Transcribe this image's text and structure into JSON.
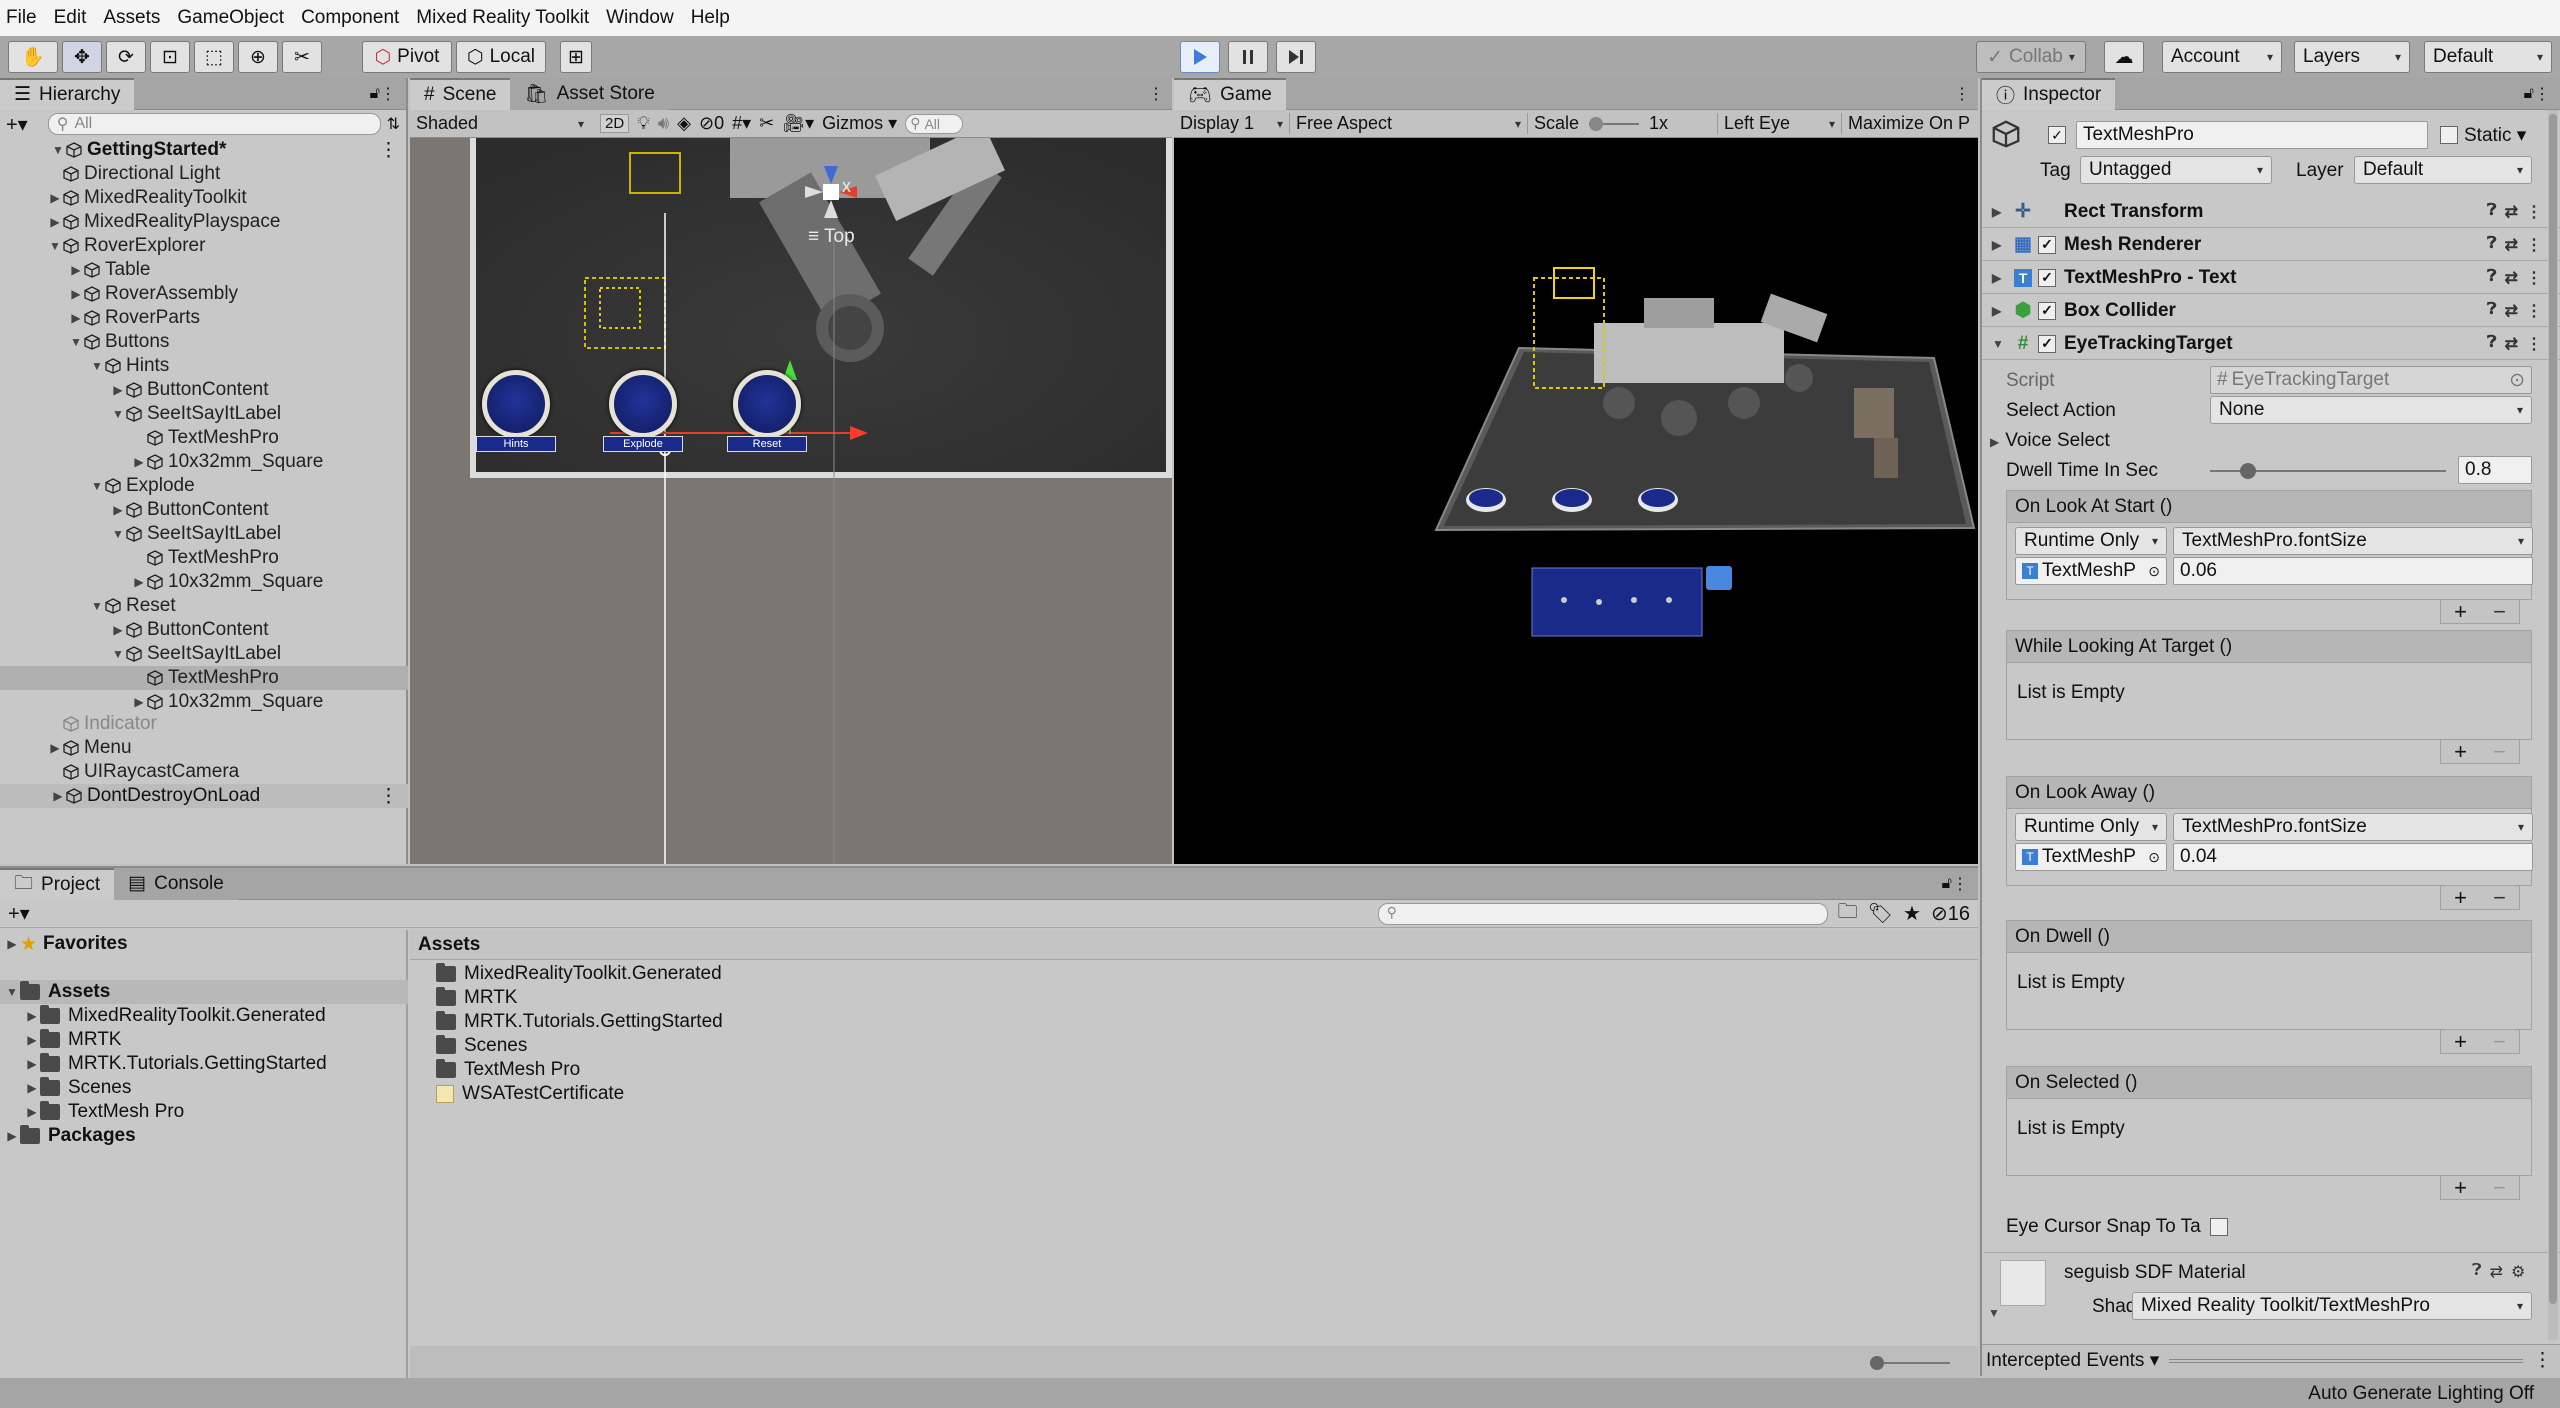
{
  "menu": [
    "File",
    "Edit",
    "Assets",
    "GameObject",
    "Component",
    "Mixed Reality Toolkit",
    "Window",
    "Help"
  ],
  "toolbar": {
    "pivot": "Pivot",
    "local": "Local",
    "collab": "Collab",
    "account": "Account",
    "layers": "Layers",
    "layout": "Default"
  },
  "hierarchy": {
    "tab": "Hierarchy",
    "search_placeholder": "All",
    "scene": "GettingStarted*",
    "items": [
      {
        "label": "Directional Light",
        "depth": 1,
        "arrow": ""
      },
      {
        "label": "MixedRealityToolkit",
        "depth": 1,
        "arrow": "▶"
      },
      {
        "label": "MixedRealityPlayspace",
        "depth": 1,
        "arrow": "▶"
      },
      {
        "label": "RoverExplorer",
        "depth": 1,
        "arrow": "▼"
      },
      {
        "label": "Table",
        "depth": 2,
        "arrow": "▶"
      },
      {
        "label": "RoverAssembly",
        "depth": 2,
        "arrow": "▶"
      },
      {
        "label": "RoverParts",
        "depth": 2,
        "arrow": "▶"
      },
      {
        "label": "Buttons",
        "depth": 2,
        "arrow": "▼"
      },
      {
        "label": "Hints",
        "depth": 3,
        "arrow": "▼"
      },
      {
        "label": "ButtonContent",
        "depth": 4,
        "arrow": "▶"
      },
      {
        "label": "SeeItSayItLabel",
        "depth": 4,
        "arrow": "▼"
      },
      {
        "label": "TextMeshPro",
        "depth": 5,
        "arrow": ""
      },
      {
        "label": "10x32mm_Square",
        "depth": 5,
        "arrow": "▶"
      },
      {
        "label": "Explode",
        "depth": 3,
        "arrow": "▼"
      },
      {
        "label": "ButtonContent",
        "depth": 4,
        "arrow": "▶"
      },
      {
        "label": "SeeItSayItLabel",
        "depth": 4,
        "arrow": "▼"
      },
      {
        "label": "TextMeshPro",
        "depth": 5,
        "arrow": ""
      },
      {
        "label": "10x32mm_Square",
        "depth": 5,
        "arrow": "▶"
      },
      {
        "label": "Reset",
        "depth": 3,
        "arrow": "▼"
      },
      {
        "label": "ButtonContent",
        "depth": 4,
        "arrow": "▶"
      },
      {
        "label": "SeeItSayItLabel",
        "depth": 4,
        "arrow": "▼"
      },
      {
        "label": "TextMeshPro",
        "depth": 5,
        "arrow": "",
        "selected": true
      },
      {
        "label": "10x32mm_Square",
        "depth": 5,
        "arrow": "▶"
      },
      {
        "label": "Indicator",
        "depth": 1,
        "arrow": "",
        "disabled": true
      },
      {
        "label": "Menu",
        "depth": 1,
        "arrow": "▶"
      },
      {
        "label": "UIRaycastCamera",
        "depth": 1,
        "arrow": ""
      }
    ],
    "dont_destroy": "DontDestroyOnLoad"
  },
  "scene": {
    "tab": "Scene",
    "tab2": "Asset Store",
    "shading": "Shaded",
    "mode2d": "2D",
    "hidden_count": "0",
    "gizmos": "Gizmos",
    "search_placeholder": "All",
    "orientation": "Top",
    "axis_x": "x",
    "buttons": [
      "Hints",
      "Explode",
      "Reset"
    ]
  },
  "game": {
    "tab": "Game",
    "display": "Display 1",
    "aspect": "Free Aspect",
    "scale_label": "Scale",
    "scale_value": "1x",
    "eye": "Left Eye",
    "maximize": "Maximize On P"
  },
  "inspector": {
    "tab": "Inspector",
    "object_name": "TextMeshPro",
    "static_label": "Static",
    "tag_label": "Tag",
    "tag_value": "Untagged",
    "layer_label": "Layer",
    "layer_value": "Default",
    "components": [
      "Rect Transform",
      "Mesh Renderer",
      "TextMeshPro - Text",
      "Box Collider",
      "EyeTrackingTarget"
    ],
    "script_label": "Script",
    "script_value": "EyeTrackingTarget",
    "select_action_label": "Select Action",
    "select_action_value": "None",
    "voice_select": "Voice Select",
    "dwell_label": "Dwell Time In Sec",
    "dwell_value": "0.8",
    "dwell_fraction": 0.16,
    "events": [
      {
        "title": "On Look At Start ()",
        "runtime": "Runtime Only",
        "func": "TextMeshPro.fontSize",
        "obj": "TextMeshP",
        "value": "0.06"
      },
      {
        "title": "While Looking At Target ()",
        "empty": "List is Empty"
      },
      {
        "title": "On Look Away ()",
        "runtime": "Runtime Only",
        "func": "TextMeshPro.fontSize",
        "obj": "TextMeshP",
        "value": "0.04"
      },
      {
        "title": "On Dwell ()",
        "empty": "List is Empty"
      },
      {
        "title": "On Selected ()",
        "empty": "List is Empty"
      }
    ],
    "eye_cursor": "Eye Cursor Snap To Ta",
    "material_name": "seguisb SDF Material",
    "shader_label": "Shader",
    "shader_value": "Mixed Reality Toolkit/TextMeshPro",
    "intercepted": "Intercepted Events"
  },
  "project": {
    "tab": "Project",
    "tab2": "Console",
    "favorites": "Favorites",
    "assets": "Assets",
    "packages": "Packages",
    "tree": [
      "MixedRealityToolkit.Generated",
      "MRTK",
      "MRTK.Tutorials.GettingStarted",
      "Scenes",
      "TextMesh Pro"
    ],
    "breadcrumb": "Assets",
    "files": [
      "MixedRealityToolkit.Generated",
      "MRTK",
      "MRTK.Tutorials.GettingStarted",
      "Scenes",
      "TextMesh Pro",
      "WSATestCertificate"
    ],
    "hidden_count": "16"
  },
  "status": {
    "text": "Auto Generate Lighting Off"
  },
  "colors": {
    "play_blue": "#3d7fd6",
    "button_blue": "#1a2a8a",
    "scene_bg": "#474747",
    "game_bg": "#000000"
  }
}
